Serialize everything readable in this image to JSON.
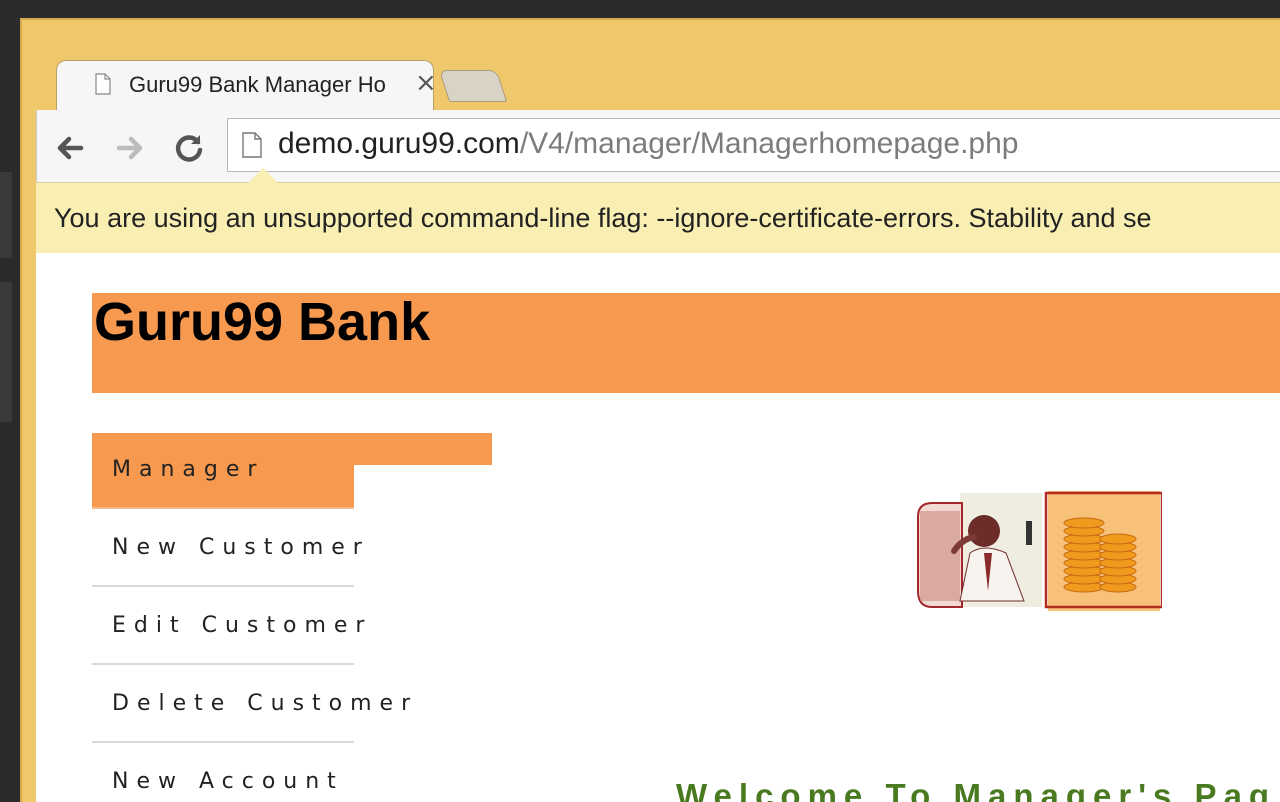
{
  "browser": {
    "tab_title": "Guru99 Bank Manager Ho",
    "url_host": "demo.guru99.com",
    "url_path": "/V4/manager/Managerhomepage.php",
    "infobar_message": "You are using an unsupported command-line flag: --ignore-certificate-errors. Stability and se"
  },
  "page": {
    "bank_name": "Guru99 Bank",
    "menu": [
      {
        "label": "Manager",
        "active": true
      },
      {
        "label": "New Customer"
      },
      {
        "label": "Edit Customer"
      },
      {
        "label": "Delete Customer"
      },
      {
        "label": "New Account"
      }
    ],
    "welcome": "Welcome To Manager's Pag"
  },
  "colors": {
    "header_bg": "#f79a4f",
    "welcome_text": "#4a7a1f",
    "infobar_bg": "#faefb3",
    "frame": "#efc86b"
  },
  "icons": [
    "file-icon",
    "close-icon",
    "back-arrow-icon",
    "forward-arrow-icon",
    "reload-icon"
  ]
}
